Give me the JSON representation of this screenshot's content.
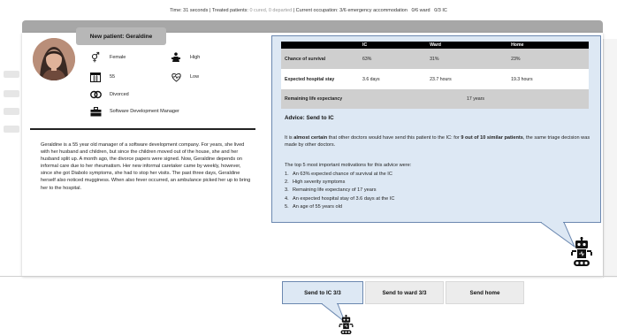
{
  "status": {
    "time": "Time: 31 seconds",
    "treated_label": "Treated patients:",
    "treated_value": "0 cured, 0 departed",
    "occupation_label": "Current occupation:",
    "occupation_value": "3/6 emergency accommodation",
    "ward": "0/6 ward",
    "ic": "0/3 IC"
  },
  "patient": {
    "title": "New patient: Geraldine",
    "gender": "Female",
    "severity": "High",
    "age": "55",
    "health": "Low",
    "marital": "Divorced",
    "job": "Software Development Manager",
    "story": "Geraldine is a 55 year old manager of a software development company. For years, she lived with her husband and children, but since the children moved out of the house, she and her husband split up. A month ago, the divorce papers were signed. Now, Geraldine depends on informal care due to her rheumatism. Her new informal caretaker came by weekly, however, since she got Diabolo symptoms, she had to stop her visits. The past three days, Geraldine herself also noticed mugginess. When also fever occurred, an ambulance picked her up to bring her to the hospital."
  },
  "table": {
    "headers": [
      "",
      "IC",
      "Ward",
      "Home"
    ],
    "rows": [
      {
        "label": "Chance of survival",
        "values": [
          "63%",
          "31%",
          "23%"
        ]
      },
      {
        "label": "Expected hospital stay",
        "values": [
          "3.6 days",
          "23.7 hours",
          "19.3 hours"
        ]
      },
      {
        "label": "Remaining life expectancy",
        "value": "17 years"
      }
    ]
  },
  "advice": {
    "heading": "Advice: Send to IC",
    "p1_start": "It is ",
    "p1_bold1": "almost certain",
    "p1_mid": " that other doctors would have send this patient to the IC: for ",
    "p1_bold2": "9 out of 10 similar patients",
    "p1_end": ", the same triage decision was made by other doctors.",
    "intro": "The top 5 most important motivations for this advice were:",
    "items": [
      "An 63% expected chance of survival at the IC",
      "High severity symptoms",
      "Remaining life expectancy of 17 years",
      "An expected hospital stay of 3.6 days at the IC",
      "An age of 55 years old"
    ]
  },
  "buttons": {
    "ic": "Send to IC 3/3",
    "ward": "Send to ward 3/3",
    "home": "Send home"
  },
  "icons": [
    "gender-icon",
    "severity-icon",
    "calendar-icon",
    "health-icon",
    "rings-icon",
    "briefcase-icon",
    "robot-icon"
  ],
  "colors": {
    "advice_bg": "#dde8f4",
    "advice_border": "#6b88b0",
    "table_header": "#000000",
    "header_bar": "#a7a7a7"
  }
}
